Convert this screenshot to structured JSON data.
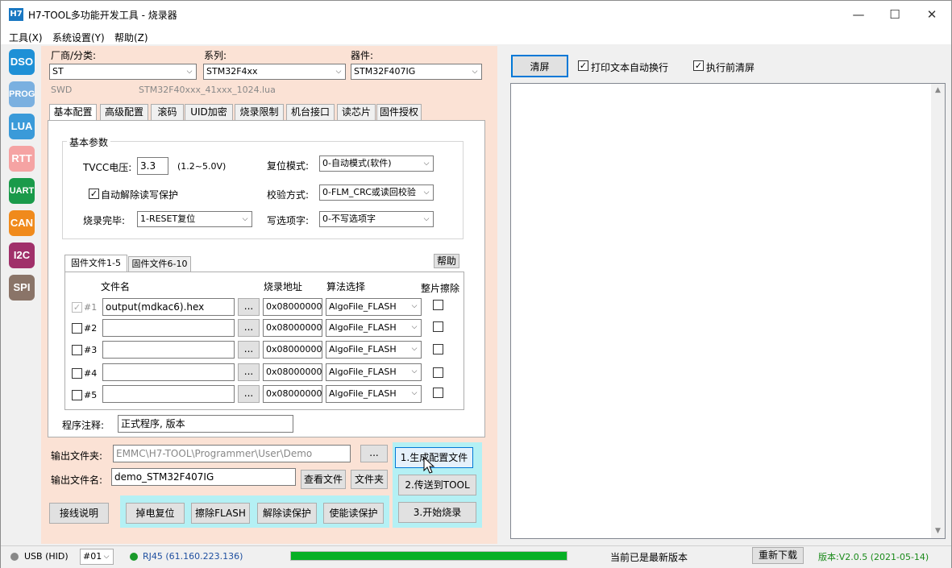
{
  "window": {
    "title": "H7-TOOL多功能开发工具 - 烧录器",
    "app_icon": "H7"
  },
  "menu": [
    "工具(X)",
    "系统设置(Y)",
    "帮助(Z)"
  ],
  "sidebar": [
    {
      "label": "DSO",
      "color": "#1e90d6"
    },
    {
      "label": "PROG",
      "color": "#7ab0e0"
    },
    {
      "label": "LUA",
      "color": "#3a9ad9"
    },
    {
      "label": "RTT",
      "color": "#f5a3a3"
    },
    {
      "label": "UART",
      "color": "#1a9a4a"
    },
    {
      "label": "CAN",
      "color": "#f08a1c"
    },
    {
      "label": "I2C",
      "color": "#a0306a"
    },
    {
      "label": "SPI",
      "color": "#8a7468"
    }
  ],
  "selectors": {
    "vendor_label": "厂商/分类:",
    "vendor_value": "ST",
    "series_label": "系列:",
    "series_value": "STM32F4xx",
    "device_label": "器件:",
    "device_value": "STM32F407IG",
    "interface": "SWD",
    "lua_file": "STM32F40xxx_41xxx_1024.lua"
  },
  "tabs": [
    "基本配置",
    "高级配置",
    "滚码",
    "UID加密",
    "烧录限制",
    "机台接口",
    "读芯片",
    "固件授权"
  ],
  "basic": {
    "group_title": "基本参数",
    "tvcc_label": "TVCC电压:",
    "tvcc_value": "3.3",
    "tvcc_range": "(1.2~5.0V)",
    "reset_label": "复位模式:",
    "reset_value": "0-自动模式(软件)",
    "auto_unprotect": "自动解除读写保护",
    "verify_label": "校验方式:",
    "verify_value": "0-FLM_CRC或读回校验",
    "done_label": "烧录完毕:",
    "done_value": "1-RESET复位",
    "option_label": "写选项字:",
    "option_value": "0-不写选项字"
  },
  "firmware": {
    "tab1": "固件文件1-5",
    "tab2": "固件文件6-10",
    "help": "帮助",
    "col_file": "文件名",
    "col_addr": "烧录地址",
    "col_algo": "算法选择",
    "col_erase": "整片擦除",
    "rows": [
      {
        "num": "#1",
        "file": "output(mdkac6).hex",
        "addr": "0x08000000",
        "algo": "AlgoFile_FLASH",
        "checked": "✓"
      },
      {
        "num": "#2",
        "file": "",
        "addr": "0x08000000",
        "algo": "AlgoFile_FLASH",
        "checked": ""
      },
      {
        "num": "#3",
        "file": "",
        "addr": "0x08000000",
        "algo": "AlgoFile_FLASH",
        "checked": ""
      },
      {
        "num": "#4",
        "file": "",
        "addr": "0x08000000",
        "algo": "AlgoFile_FLASH",
        "checked": ""
      },
      {
        "num": "#5",
        "file": "",
        "addr": "0x08000000",
        "algo": "AlgoFile_FLASH",
        "checked": ""
      }
    ],
    "browse": "...",
    "comment_label": "程序注释:",
    "comment_value": "正式程序, 版本"
  },
  "output": {
    "folder_label": "输出文件夹:",
    "folder_value": "EMMC\\H7-TOOL\\Programmer\\User\\Demo",
    "name_label": "输出文件名:",
    "name_value": "demo_STM32F407IG",
    "view_file": "查看文件",
    "open_folder": "文件夹",
    "browse": "..."
  },
  "actions": {
    "wiring": "接线说明",
    "power_reset": "掉电复位",
    "erase_flash": "擦除FLASH",
    "unprotect": "解除读保护",
    "protect": "使能读保护",
    "gen_config": "1.生成配置文件",
    "send_tool": "2.传送到TOOL",
    "start": "3.开始烧录"
  },
  "right": {
    "clear": "清屏",
    "wrap": "打印文本自动换行",
    "clear_before": "执行前清屏"
  },
  "status": {
    "usb": "USB (HID)",
    "port": "#01",
    "rj45": "RJ45 (61.160.223.136)",
    "progress": 1.0,
    "message": "当前已是最新版本",
    "redownload": "重新下载",
    "version": "版本:V2.0.5 (2021-05-14)"
  }
}
